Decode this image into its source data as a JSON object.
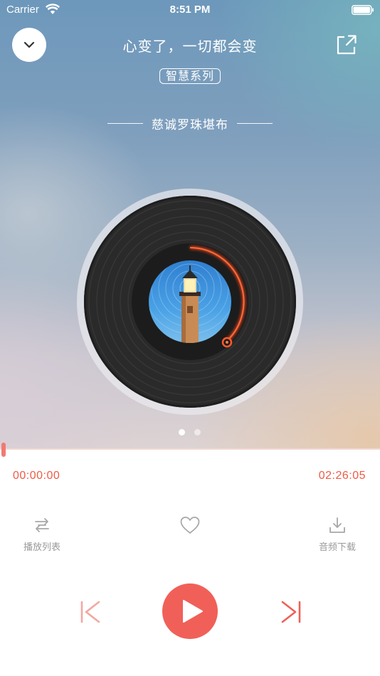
{
  "status_bar": {
    "carrier": "Carrier",
    "time": "8:51 PM"
  },
  "header": {
    "title": "心变了，一切都会变",
    "series": "智慧系列",
    "artist": "慈诚罗珠堪布"
  },
  "player": {
    "current_time": "00:00:00",
    "total_time": "02:26:05",
    "progress_fraction": 0.0,
    "page_count": 2,
    "active_page": 1
  },
  "actions": {
    "playlist_label": "播放列表",
    "download_label": "音频下载"
  },
  "icons": {
    "collapse": "chevron-down-icon",
    "share": "share-icon",
    "playlist": "repeat-list-icon",
    "favorite": "heart-icon",
    "download": "download-icon",
    "prev": "skip-previous-icon",
    "play": "play-icon",
    "next": "skip-next-icon",
    "cover": "lighthouse-star-trails-image"
  },
  "colors": {
    "accent": "#f06058",
    "time_text": "#f05a45",
    "label_text": "#9a9a9a",
    "icon_gray": "#a8a8a8",
    "prev_disabled": "#f3a8a2",
    "next_active": "#f06058"
  }
}
